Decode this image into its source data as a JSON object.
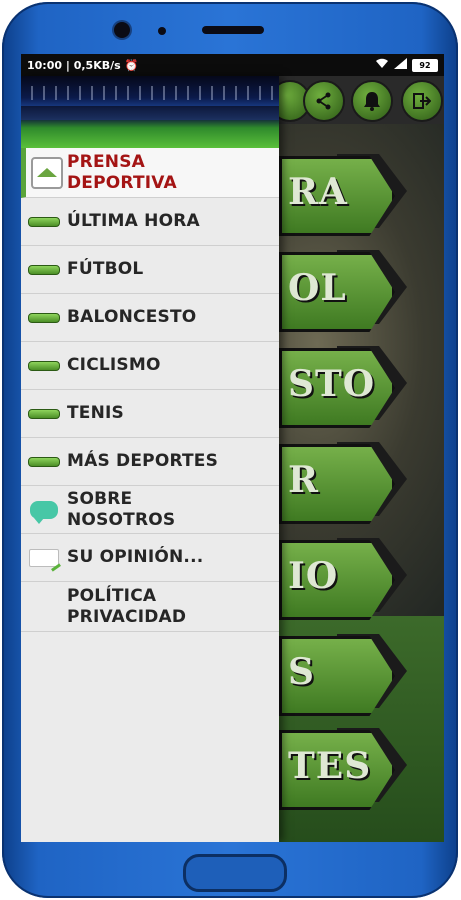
{
  "status_bar": {
    "time": "10:00",
    "speed": "0,5KB/s",
    "battery": "92",
    "icons": [
      "alarm-icon",
      "wifi-icon",
      "signal-icon",
      "battery-icon"
    ]
  },
  "background_app": {
    "toolbar_icons": [
      "share-icon",
      "bell-icon",
      "exit-icon"
    ],
    "section_fragments": [
      "RA",
      "OL",
      "STO",
      "R",
      "IO",
      "S",
      "TES"
    ]
  },
  "drawer": {
    "header_image": "stadium-image",
    "items": [
      {
        "label": "PRENSA DEPORTIVA",
        "icon": "home-icon",
        "active": true
      },
      {
        "label": "ÚLTIMA HORA",
        "icon": "ball-icon"
      },
      {
        "label": "FÚTBOL",
        "icon": "ball-icon"
      },
      {
        "label": "BALONCESTO",
        "icon": "ball-icon"
      },
      {
        "label": "CICLISMO",
        "icon": "ball-icon"
      },
      {
        "label": "TENIS",
        "icon": "ball-icon"
      },
      {
        "label": "MÁS DEPORTES",
        "icon": "ball-icon"
      },
      {
        "label": "SOBRE NOSOTROS",
        "icon": "chat-icon"
      },
      {
        "label": "SU OPINIÓN...",
        "icon": "pencil-icon"
      },
      {
        "label": "POLÍTICA PRIVACIDAD",
        "icon": ""
      }
    ]
  },
  "colors": {
    "accent": "#5aa43a",
    "active_text": "#a41414",
    "drawer_bg": "#ebebeb",
    "phone_frame": "#1f64c4"
  }
}
